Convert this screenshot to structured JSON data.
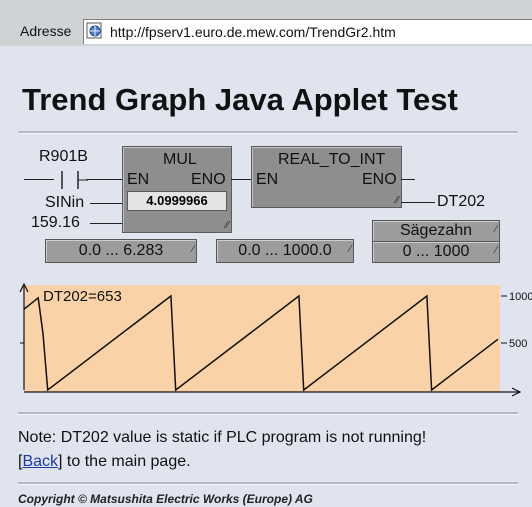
{
  "address_bar": {
    "label": "Adresse",
    "url": "http://fpserv1.euro.de.mew.com/TrendGr2.htm"
  },
  "page": {
    "title": "Trend Graph Java Applet Test",
    "note": "Note: DT202 value is static if PLC program is not running!",
    "back_link": "Back",
    "back_suffix": " to the main page.",
    "copyright": "Copyright © Matsushita Electric Works (Europe) AG"
  },
  "diagram": {
    "contact_label": "R901B",
    "input_label": "SINin",
    "input_value": "159.16",
    "mul_title": "MUL",
    "mul_en": "EN",
    "mul_eno": "ENO",
    "mul_value": "4.0999966",
    "conv_title": "REAL_TO_INT",
    "conv_en": "EN",
    "conv_eno": "ENO",
    "output_label": "DT202",
    "range1": "0.0 ... 6.283",
    "range2": "0.0 ... 1000.0",
    "range3_title": "Sägezahn",
    "range3": "0 ... 1000"
  },
  "chart_data": {
    "type": "line",
    "title": "DT202=653",
    "y_ticks": [
      "1000",
      "500"
    ],
    "ylim": [
      0,
      1000
    ],
    "x": [
      0,
      3,
      4,
      5,
      31,
      32,
      58,
      59,
      85,
      86,
      100
    ],
    "values": [
      860,
      980,
      600,
      0,
      1000,
      0,
      1000,
      0,
      1000,
      0,
      540
    ],
    "background_color": "#fad2a7"
  }
}
